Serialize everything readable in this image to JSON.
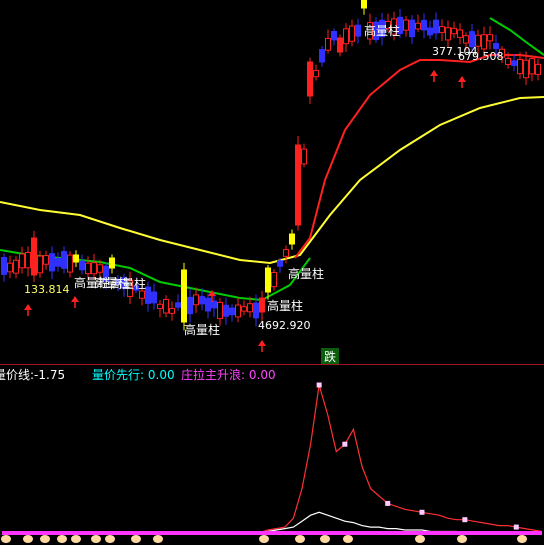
{
  "colors": {
    "background": "#000000",
    "up_candle": "#ff2020",
    "down_candle": "#3030ff",
    "highlight_candle": "#ffff00",
    "ma_fast": "#ff2020",
    "ma_mid": "#00cc00",
    "ma_slow": "#ffff33",
    "separator": "#a0141e",
    "label_text": "#ffffff",
    "annotation_text": "#ffff66",
    "arrow": "#ff2020",
    "volume_line": "#ff3030",
    "lead_line": "#ffffff",
    "bottom_band": "#ff33ff",
    "sell_badge_bg": "#0b5e0b",
    "sell_badge_text": "#ffffff",
    "legend_main": "#ffffff",
    "legend_lead": "#00ffff",
    "legend_rise": "#ff44ff"
  },
  "main_chart": {
    "annotations": [
      {
        "text": "高量柱",
        "kind": "high-volume-bar"
      },
      {
        "text": "高量柱",
        "kind": "high-volume-bar"
      },
      {
        "text": "高量柱",
        "kind": "high-volume-bar"
      },
      {
        "text": "高量柱",
        "kind": "high-volume-bar"
      },
      {
        "text": "高量柱",
        "kind": "high-volume-bar"
      },
      {
        "text": "高量柱",
        "kind": "high-volume-bar"
      },
      {
        "text": "高量柱",
        "kind": "high-volume-bar"
      }
    ],
    "price_labels": [
      {
        "text": "133.814"
      },
      {
        "text": "4692.920"
      },
      {
        "text": "377.104"
      },
      {
        "text": "679.508"
      }
    ],
    "sell_badge": {
      "text": "跌"
    }
  },
  "indicator_legend": {
    "volume_price_line": {
      "label": "量价线:",
      "value": "-1.75"
    },
    "volume_price_lead": {
      "label": "量价先行:",
      "value": "0.00"
    },
    "dealer_rise": {
      "label": "庄拉主升浪:",
      "value": "0.00"
    }
  },
  "chart_data": [
    {
      "type": "candlestick",
      "title": "",
      "series": [
        {
          "name": "",
          "kind": "candles"
        },
        {
          "name": "",
          "kind": "ma_fast"
        },
        {
          "name": "",
          "kind": "ma_mid"
        },
        {
          "name": "",
          "kind": "ma_slow"
        }
      ],
      "grid": false
    },
    {
      "type": "line",
      "title": "",
      "series": [
        {
          "name": "量价线",
          "values": [
            0,
            0,
            0,
            0,
            0,
            0,
            0,
            0,
            0,
            0,
            0,
            0,
            0,
            0,
            0,
            0,
            0,
            0,
            0,
            0,
            0,
            0,
            0,
            0,
            0,
            0,
            0,
            0,
            0,
            0,
            0,
            2,
            3,
            4,
            10,
            30,
            60,
            100,
            80,
            55,
            60,
            70,
            45,
            30,
            25,
            20,
            18,
            16,
            15,
            14,
            13,
            12,
            10,
            9,
            9,
            8,
            7,
            6,
            5,
            5,
            4,
            3,
            2,
            1
          ]
        },
        {
          "name": "量价先行",
          "values": [
            0,
            0,
            0,
            0,
            0,
            0,
            0,
            0,
            0,
            0,
            0,
            0,
            0,
            0,
            0,
            0,
            0,
            0,
            0,
            0,
            0,
            0,
            0,
            0,
            0,
            0,
            0,
            0,
            0,
            0,
            0,
            1,
            2,
            3,
            4,
            8,
            12,
            14,
            12,
            10,
            8,
            7,
            5,
            4,
            4,
            3,
            3,
            2,
            2,
            2,
            1,
            1,
            1,
            1,
            0,
            0,
            0,
            0,
            0,
            0,
            0,
            0,
            0,
            0
          ]
        },
        {
          "name": "庄拉主升浪",
          "values": [
            0,
            0,
            0,
            0,
            0,
            0,
            0,
            0,
            0,
            0,
            0,
            0,
            0,
            0,
            0,
            0,
            0,
            0,
            0,
            0,
            0,
            0,
            0,
            0,
            0,
            0,
            0,
            0,
            0,
            0,
            0,
            0,
            0,
            0,
            0,
            0,
            0,
            0,
            0,
            0,
            0,
            0,
            0,
            0,
            0,
            0,
            0,
            0,
            0,
            0,
            0,
            0,
            0,
            0,
            0,
            0,
            0,
            0,
            0,
            0,
            0,
            0,
            0,
            0
          ]
        }
      ],
      "grid": false
    }
  ]
}
